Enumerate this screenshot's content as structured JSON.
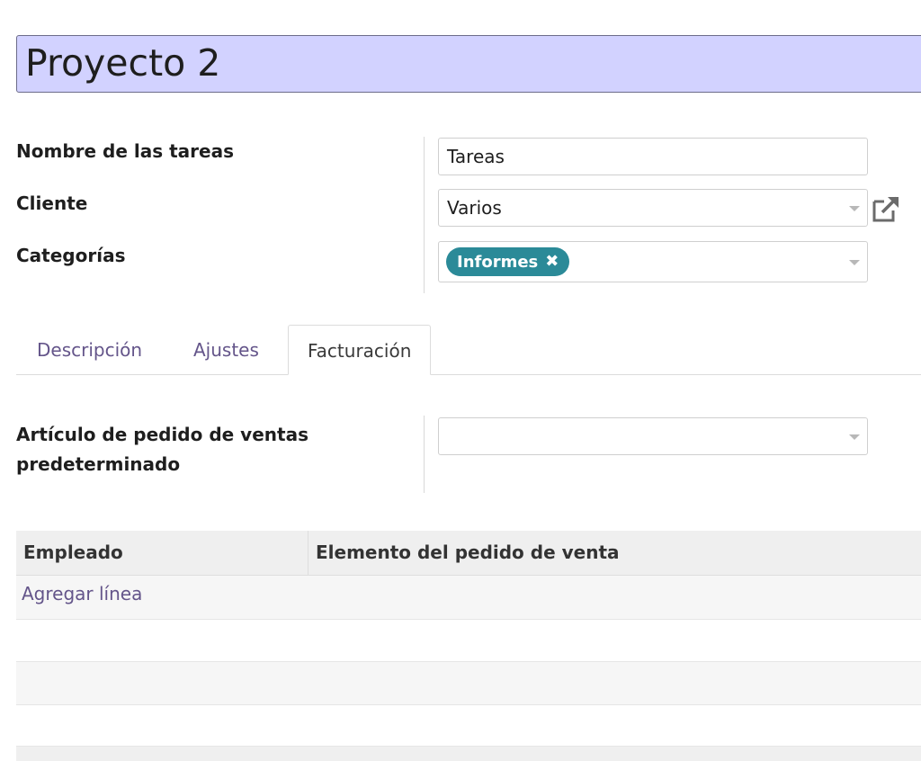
{
  "title": "Proyecto 2",
  "fields": {
    "task_name": {
      "label": "Nombre de las tareas",
      "value": "Tareas"
    },
    "customer": {
      "label": "Cliente",
      "value": "Varios"
    },
    "categories": {
      "label": "Categorías",
      "tags": [
        "Informes"
      ]
    }
  },
  "tabs": [
    {
      "label": "Descripción",
      "active": false
    },
    {
      "label": "Ajustes",
      "active": false
    },
    {
      "label": "Facturación",
      "active": true
    }
  ],
  "billing": {
    "default_sale_line_label_1": "Artículo de pedido de ventas",
    "default_sale_line_label_2": "predeterminado",
    "default_sale_line_value": ""
  },
  "table": {
    "columns": [
      "Empleado",
      "Elemento del pedido de venta"
    ],
    "add_line": "Agregar línea"
  },
  "colors": {
    "title_bg": "#d2d2ff",
    "tag_bg": "#2b8a98",
    "link": "#64558a"
  },
  "icons": {
    "external_link": "external-link-icon",
    "tag_remove": "close-icon",
    "dropdown": "chevron-down-icon"
  }
}
